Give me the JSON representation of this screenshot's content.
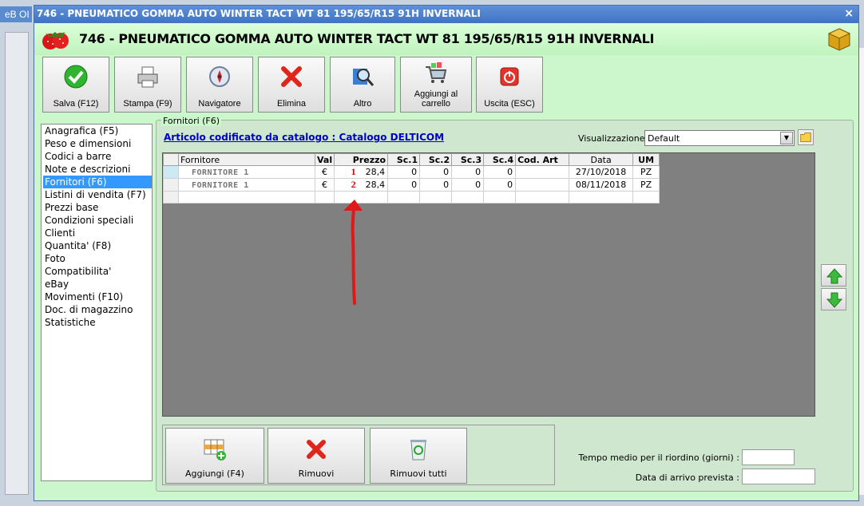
{
  "background_window": {
    "title": "eB OI"
  },
  "window": {
    "title": "746 - PNEUMATICO GOMMA AUTO WINTER TACT WT 81 195/65/R15 91H INVERNALI",
    "close_glyph": "×"
  },
  "header": {
    "title": "746 - PNEUMATICO GOMMA AUTO WINTER TACT WT 81 195/65/R15 91H INVERNALI"
  },
  "toolbar": [
    {
      "label": "Salva (F12)",
      "icon": "check-icon"
    },
    {
      "label": "Stampa (F9)",
      "icon": "printer-icon"
    },
    {
      "label": "Navigatore",
      "icon": "compass-icon"
    },
    {
      "label": "Elimina",
      "icon": "red-x-icon"
    },
    {
      "label": "Altro",
      "icon": "magnifier-icon"
    },
    {
      "label": "Aggiungi al carrello",
      "icon": "cart-icon"
    },
    {
      "label": "Uscita (ESC)",
      "icon": "power-icon"
    }
  ],
  "sidebar": {
    "selected_index": 4,
    "items": [
      "Anagrafica (F5)",
      "Peso e dimensioni",
      "Codici a barre",
      "Note e descrizioni",
      "Fornitori (F6)",
      "Listini di vendita (F7)",
      "Prezzi base",
      "Condizioni speciali",
      "Clienti",
      "Quantita' (F8)",
      "Foto",
      "Compatibilita'",
      "eBay",
      "Movimenti (F10)",
      "Doc. di magazzino",
      "Statistiche"
    ]
  },
  "panel": {
    "title": "Fornitori (F6)",
    "catalog_link": "Articolo codificato da catalogo : Catalogo DELTICOM",
    "view_label": "Visualizzazione :",
    "view_value": "Default"
  },
  "grid": {
    "columns": [
      "Fornitore",
      "Val",
      "Prezzo",
      "Sc.1",
      "Sc.2",
      "Sc.3",
      "Sc.4",
      "Cod. Art",
      "Data",
      "UM"
    ],
    "rows": [
      {
        "annotation": "1",
        "fornitore": "FORNITORE 1",
        "val": "€",
        "prezzo": "28,4",
        "sc1": "0",
        "sc2": "0",
        "sc3": "0",
        "sc4": "0",
        "cod_art": "",
        "data": "27/10/2018",
        "um": "PZ"
      },
      {
        "annotation": "2",
        "fornitore": "FORNITORE 1",
        "val": "€",
        "prezzo": "28,4",
        "sc1": "0",
        "sc2": "0",
        "sc3": "0",
        "sc4": "0",
        "cod_art": "",
        "data": "08/11/2018",
        "um": "PZ"
      }
    ]
  },
  "bottom_buttons": [
    {
      "label": "Aggiungi (F4)",
      "icon": "add-grid-icon"
    },
    {
      "label": "Rimuovi",
      "icon": "red-x-icon"
    },
    {
      "label": "Rimuovi tutti",
      "icon": "recycle-bin-icon"
    }
  ],
  "fields": {
    "reorder_label": "Tempo medio per il riordino (giorni) :",
    "reorder_value": "",
    "arrival_label": "Data di arrivo prevista :",
    "arrival_value": ""
  },
  "colors": {
    "accent": "#3399ff",
    "window_bg": "#ccf7cc",
    "annotation": "#e00000"
  }
}
